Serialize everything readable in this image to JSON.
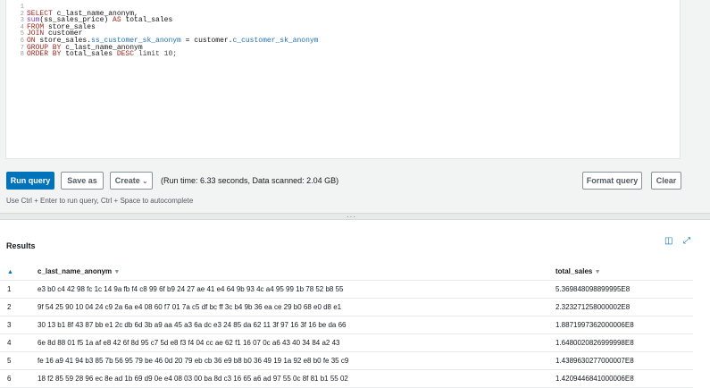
{
  "editor": {
    "lines": [
      {
        "n": "1",
        "segments": []
      },
      {
        "n": "2",
        "segments": [
          {
            "t": "SELECT",
            "c": "kw"
          },
          {
            "t": " c_last_name_anonym,",
            "c": ""
          }
        ]
      },
      {
        "n": "3",
        "segments": [
          {
            "t": "sum",
            "c": "fn"
          },
          {
            "t": "(ss_sales_price) ",
            "c": ""
          },
          {
            "t": "AS",
            "c": "kw"
          },
          {
            "t": " total_sales",
            "c": ""
          }
        ]
      },
      {
        "n": "4",
        "segments": [
          {
            "t": "FROM",
            "c": "kw"
          },
          {
            "t": " store_sales",
            "c": ""
          }
        ]
      },
      {
        "n": "5",
        "segments": [
          {
            "t": "JOIN",
            "c": "kw"
          },
          {
            "t": " customer",
            "c": ""
          }
        ]
      },
      {
        "n": "6",
        "segments": [
          {
            "t": "ON",
            "c": "kw"
          },
          {
            "t": " store_sales.",
            "c": ""
          },
          {
            "t": "ss_customer_sk_anonym",
            "c": "col"
          },
          {
            "t": " = customer.",
            "c": ""
          },
          {
            "t": "c_customer_sk_anonym",
            "c": "col"
          }
        ]
      },
      {
        "n": "7",
        "segments": [
          {
            "t": "GROUP BY",
            "c": "kw"
          },
          {
            "t": " c_last_name_anonym",
            "c": ""
          }
        ]
      },
      {
        "n": "8",
        "segments": [
          {
            "t": "ORDER BY",
            "c": "kw"
          },
          {
            "t": " total_sales ",
            "c": ""
          },
          {
            "t": "DESC",
            "c": "kw"
          },
          {
            "t": " limit 10;",
            "c": "rp"
          }
        ]
      }
    ]
  },
  "toolbar": {
    "run_label": "Run query",
    "save_as_label": "Save as",
    "create_label": "Create",
    "run_info": "(Run time: 6.33 seconds, Data scanned: 2.04 GB)",
    "format_label": "Format query",
    "clear_label": "Clear",
    "hint": "Use Ctrl + Enter to run query, Ctrl + Space to autocomplete"
  },
  "results": {
    "title": "Results",
    "columns": [
      "c_last_name_anonym",
      "total_sales"
    ],
    "rows": [
      {
        "n": "1",
        "name": "e3 b0 c4 42 98 fc 1c 14 9a fb f4 c8 99 6f b9 24 27 ae 41 e4 64 9b 93 4c a4 95 99 1b 78 52 b8 55",
        "total": "5.369848098899995E8"
      },
      {
        "n": "2",
        "name": "9f 54 25 90 10 04 24 c9 2a 6a e4 08 60 f7 01 7a c5 df bc ff 3c b4 9b 36 ea ce 29 b0 68 e0 d8 e1",
        "total": "2.323271258000002E8"
      },
      {
        "n": "3",
        "name": "30 13 b1 8f 43 87 bb e1 2c db 6d 3b a9 aa 45 a3 6a dc e3 24 85 da 62 11 3f 97 16 3f 16 be da 66",
        "total": "1.8871997362000006E8"
      },
      {
        "n": "4",
        "name": "6e 8d 88 01 f5 1a af e8 42 6f 8d 95 c7 5d e8 f3 f4 04 cc ae 62 f1 16 07 0c a6 43 40 34 84 a2 43",
        "total": "1.6480020826999998E8"
      },
      {
        "n": "5",
        "name": "fe 16 a9 41 94 b3 85 7b 56 95 79 be 46 0d 20 79 eb cb 36 e9 b8 b0 36 49 19 1a 92 e8 b0 fe 35 c9",
        "total": "1.4389630277000007E8"
      },
      {
        "n": "6",
        "name": "18 f2 85 59 28 96 ec 8e ad 1b 69 d9 0e e4 08 03 00 ba 8d c3 16 65 a6 ad 97 55 0c 8f 81 b1 55 02",
        "total": "1.4209446841000006E8"
      }
    ]
  }
}
